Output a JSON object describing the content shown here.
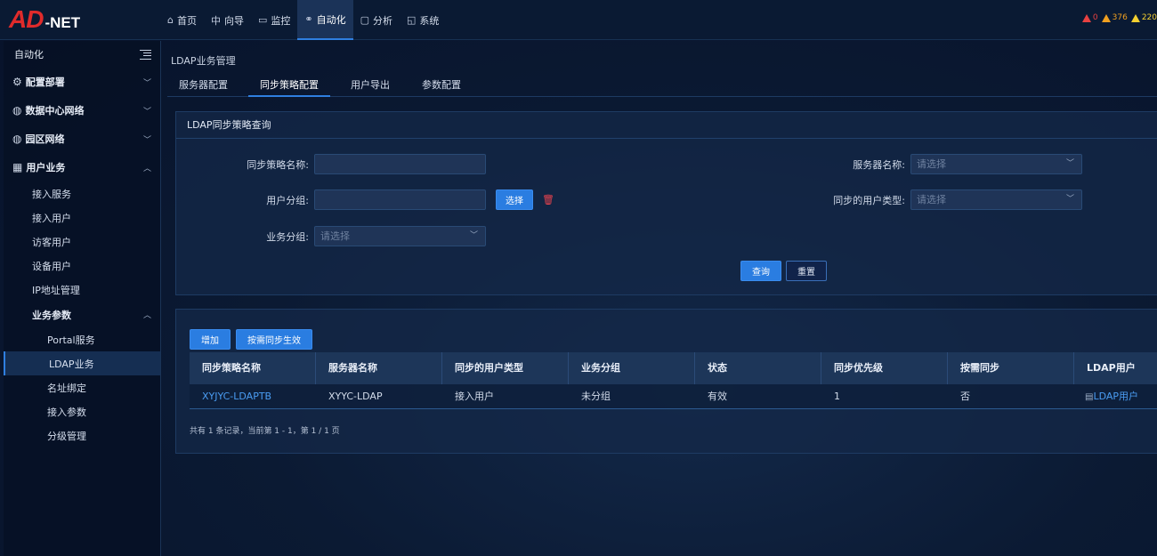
{
  "logo": {
    "mark": "AD",
    "suffix": "-NET"
  },
  "nav": [
    {
      "icon": "⌂",
      "label": "首页"
    },
    {
      "icon": "中",
      "label": "向导"
    },
    {
      "icon": "▭",
      "label": "监控"
    },
    {
      "icon": "⚭",
      "label": "自动化"
    },
    {
      "icon": "▢",
      "label": "分析"
    },
    {
      "icon": "◱",
      "label": "系统"
    }
  ],
  "alarms": [
    "0",
    "376",
    "220"
  ],
  "sidebar": {
    "title": "自动化",
    "groups": [
      {
        "icon": "⚙",
        "label": "配置部署"
      },
      {
        "icon": "◍",
        "label": "数据中心网络"
      },
      {
        "icon": "◍",
        "label": "园区网络"
      },
      {
        "icon": "▦",
        "label": "用户业务"
      }
    ],
    "items": [
      "接入服务",
      "接入用户",
      "访客用户",
      "设备用户",
      "IP地址管理"
    ],
    "subgroup": "业务参数",
    "subitems": [
      "Portal服务",
      "LDAP业务",
      "名址绑定",
      "接入参数",
      "分级管理"
    ]
  },
  "page": {
    "title": "LDAP业务管理",
    "tabs": [
      "服务器配置",
      "同步策略配置",
      "用户导出",
      "参数配置"
    ]
  },
  "query": {
    "title": "LDAP同步策略查询",
    "fields": {
      "policy_name": "同步策略名称:",
      "user_group": "用户分组:",
      "biz_group": "业务分组:",
      "server_name": "服务器名称:",
      "sync_user_type": "同步的用户类型:"
    },
    "placeholder": "请选择",
    "select_btn": "选择",
    "search_btn": "查询",
    "reset_btn": "重置"
  },
  "list": {
    "add_btn": "增加",
    "sync_btn": "按需同步生效",
    "headers": [
      "同步策略名称",
      "服务器名称",
      "同步的用户类型",
      "业务分组",
      "状态",
      "同步优先级",
      "按需同步",
      "LDAP用户"
    ],
    "rows": [
      [
        "XYJYC-LDAPTB",
        "XYYC-LDAP",
        "接入用户",
        "未分组",
        "有效",
        "1",
        "否",
        "LDAP用户"
      ]
    ],
    "pager": "共有 1 条记录，当前第 1 - 1，第 1 / 1 页"
  },
  "colors": {
    "accent": "#2a7de1",
    "link": "#4a9cf2",
    "logo_red": "#e02b2b"
  }
}
